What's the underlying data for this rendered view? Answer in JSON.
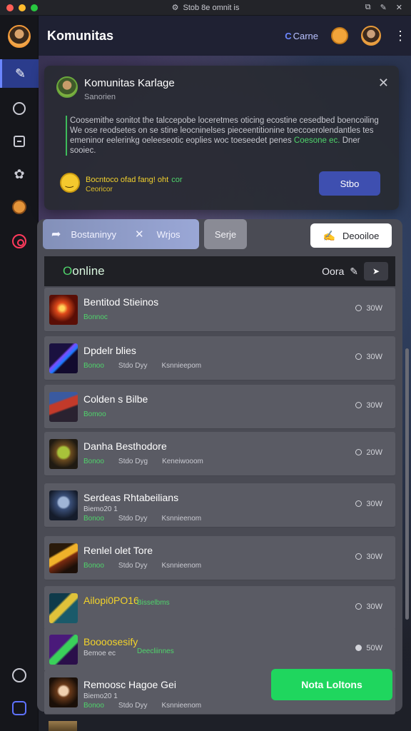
{
  "window": {
    "title": "Stob 8e omnit is"
  },
  "app": {
    "title": "Komunitas"
  },
  "topbar": {
    "game_label": "Carne"
  },
  "notice": {
    "title": "Komunitas Karlage",
    "subtitle": "Sanorien",
    "body_1": "Coosemithe sonitot the talccepobe loceretmes oticing ecostine cesedbed boencoiling",
    "body_2": "We ose reodsetes on se stine leocninelses pieceentitionine toeccoerolendantles tes",
    "body_3": "emeninor eelerinkg oeleeseotic eoplies woc toeseedet penes",
    "body_hl": "Coesone ec.",
    "body_4": "Dner",
    "body_5": "sooiec.",
    "status_1": "Bocntoco ofad fang! oht",
    "status_1b": "cor",
    "status_2": "Ceoricor",
    "button": "Stbo"
  },
  "tabs": {
    "tab1_label": "Bostaninyy",
    "tab2_label": "Wrjos",
    "tab3_label": "Serje",
    "tab4_label": "Deooiloe"
  },
  "online": {
    "label_first": "O",
    "label_rest": "online",
    "count_label": "Oora"
  },
  "games": [
    {
      "title": "Bentitod Stieinos",
      "meta": [
        "Bonnoc"
      ],
      "status": "30W"
    },
    {
      "title": "Dpdelr blies",
      "meta": [
        "Bonoo",
        "Stdo Dyy",
        "Ksnnieepom"
      ],
      "status": "30W"
    },
    {
      "title": "Colden s Bilbe",
      "meta": [
        "Bomoo"
      ],
      "status": "30W"
    },
    {
      "title": "Danha Besthodore",
      "meta": [
        "Bonoo",
        "Stdo Dyg",
        "Keneiwooom"
      ],
      "status": "20W"
    },
    {
      "title": "Serdeas Rhtabeilians",
      "sub": "Biemo20 1",
      "meta": [
        "Bonoo",
        "Stdo Dyy",
        "Ksnnieenom"
      ],
      "status": "30W"
    },
    {
      "title": "Renlel olet Tore",
      "meta": [
        "Bonoo",
        "Stdo Dyy",
        "Ksnnieenom"
      ],
      "status": "30W"
    },
    {
      "title": "Ailopi0PO16",
      "meta_inline": "Bisselbms",
      "status": "30W"
    },
    {
      "title": "Boooosesify",
      "sub": "Bemoe ec",
      "meta_inline": "Deecliinnes",
      "status": "50W"
    },
    {
      "title": "Remoosc Hagoe Gei",
      "sub": "Biemo20 1",
      "meta": [
        "Bonoo",
        "Stdo Dyy",
        "Ksnnieenom"
      ],
      "status": ""
    }
  ],
  "cta": {
    "label": "Nota Loltons"
  },
  "colors": {
    "accent": "#3e4fb0",
    "online_green": "#4fd46b",
    "cta_green": "#1fd65e",
    "alert": "#ff3a5c"
  },
  "icons": [
    "compose-icon",
    "chat-icon",
    "window-icon",
    "puzzle-icon",
    "globe-icon",
    "record-icon",
    "info-icon",
    "controller-icon",
    "close-icon",
    "kebab-icon",
    "edit-icon",
    "arrow-icon"
  ]
}
